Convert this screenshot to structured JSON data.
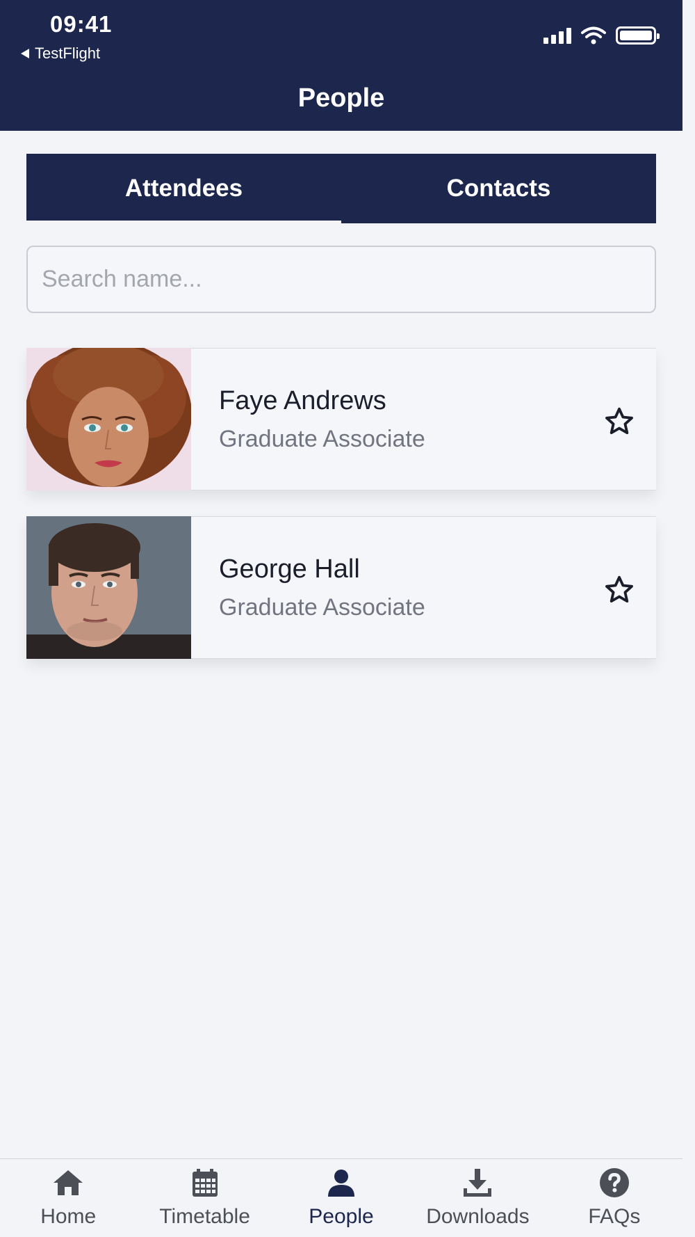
{
  "status_bar": {
    "time": "09:41",
    "back_label": "TestFlight"
  },
  "header": {
    "title": "People"
  },
  "tabs": [
    {
      "label": "Attendees",
      "active": true
    },
    {
      "label": "Contacts",
      "active": false
    }
  ],
  "search": {
    "placeholder": "Search name...",
    "value": ""
  },
  "people": [
    {
      "name": "Faye Andrews",
      "role": "Graduate Associate",
      "avatar": "avatar-photo-woman",
      "favorite": false
    },
    {
      "name": "George Hall",
      "role": "Graduate Associate",
      "avatar": "avatar-photo-man",
      "favorite": false
    }
  ],
  "bottom_nav": [
    {
      "label": "Home",
      "icon": "home-icon",
      "active": false
    },
    {
      "label": "Timetable",
      "icon": "calendar-icon",
      "active": false
    },
    {
      "label": "People",
      "icon": "person-icon",
      "active": true
    },
    {
      "label": "Downloads",
      "icon": "download-icon",
      "active": false
    },
    {
      "label": "FAQs",
      "icon": "question-circle-icon",
      "active": false
    }
  ],
  "colors": {
    "primary": "#1d274d",
    "background": "#f3f4f8",
    "muted_text": "#727480"
  }
}
